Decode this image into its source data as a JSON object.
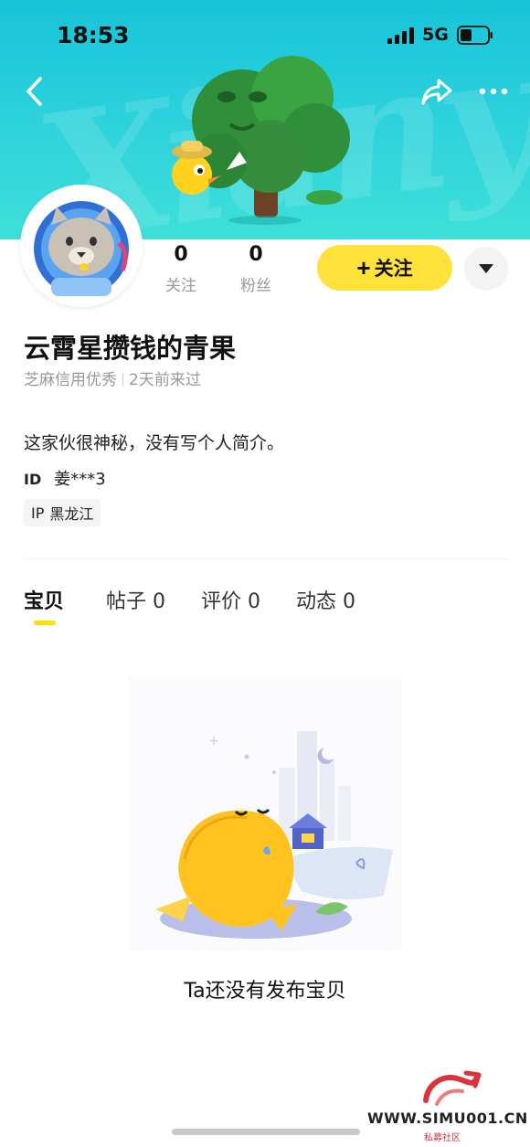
{
  "status_bar": {
    "time": "18:53",
    "network": "5G"
  },
  "banner": {
    "watermark_text": "Xianyu"
  },
  "profile": {
    "following_count": "0",
    "following_label": "关注",
    "fans_count": "0",
    "fans_label": "粉丝",
    "follow_button_plus": "+",
    "follow_button_label": "关注",
    "nickname": "云霄星攒钱的青果",
    "credit": "芝麻信用优秀",
    "last_seen": "2天前来过",
    "bio": "这家伙很神秘，没有写个人简介。",
    "id_label": "ID",
    "id_value": "姜***3",
    "ip_label": "IP",
    "ip_value": "黑龙江"
  },
  "tabs": [
    {
      "label": "宝贝",
      "active": true
    },
    {
      "label": "帖子 0",
      "active": false
    },
    {
      "label": "评价 0",
      "active": false
    },
    {
      "label": "动态 0",
      "active": false
    }
  ],
  "empty_state": {
    "message": "Ta还没有发布宝贝"
  },
  "watermark": {
    "url": "WWW.SIMU001.CN",
    "subtitle": "私募社区"
  },
  "colors": {
    "banner": "#17c4d8",
    "accent_yellow": "#ffe33a",
    "muted_text": "#999999"
  }
}
